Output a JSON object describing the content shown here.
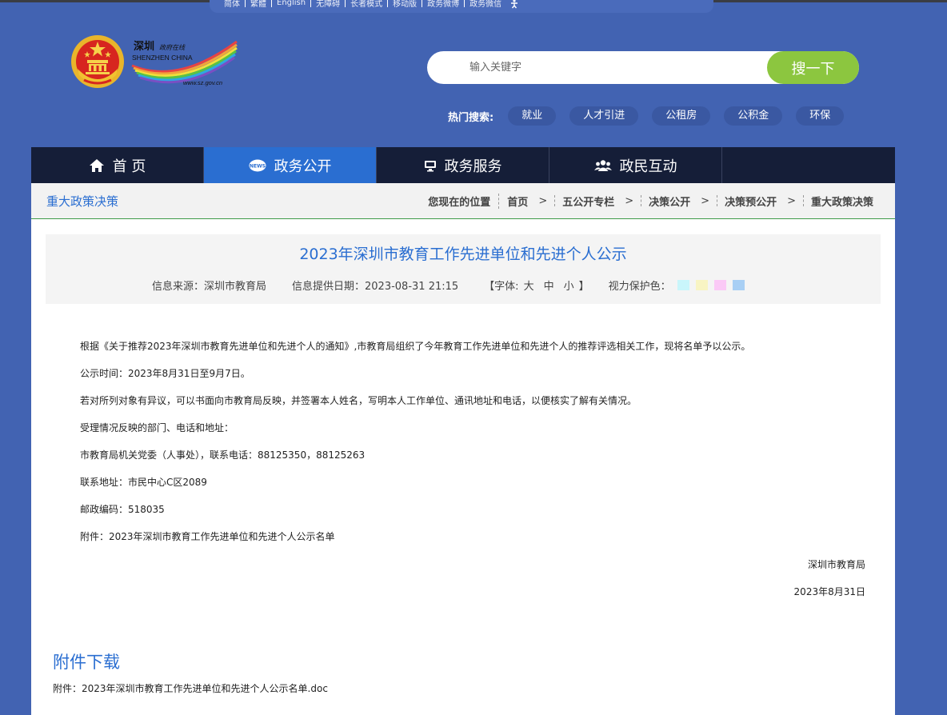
{
  "topbar": {
    "items": [
      "简体",
      "繁體",
      "English",
      "无障碍",
      "长者模式",
      "移动版",
      "政务微博",
      "政务微信"
    ]
  },
  "search": {
    "placeholder": "输入关键字",
    "button_label": "搜一下"
  },
  "hot_search": {
    "label": "热门搜索:",
    "tags": [
      "就业",
      "人才引进",
      "公租房",
      "公积金",
      "环保"
    ]
  },
  "nav": {
    "items": [
      {
        "label": "首 页",
        "icon": "home-icon"
      },
      {
        "label": "政务公开",
        "icon": "news-icon",
        "active": true
      },
      {
        "label": "政务服务",
        "icon": "monitor-icon"
      },
      {
        "label": "政民互动",
        "icon": "people-icon"
      }
    ]
  },
  "section_title": "重大政策决策",
  "breadcrumb": {
    "here_label": "您现在的位置",
    "items": [
      "首页",
      "五公开专栏",
      "决策公开",
      "决策预公开",
      "重大政策决策"
    ]
  },
  "article": {
    "title": "2023年深圳市教育工作先进单位和先进个人公示",
    "source": "信息来源：深圳市教育局",
    "date": "信息提供日期：2023-08-31 21:15",
    "font_label": "【字体:",
    "font_sizes": [
      "大",
      "中",
      "小"
    ],
    "font_end": "】",
    "eye_label": "视力保护色：",
    "eye_colors": [
      "#c9f6fb",
      "#f8f4c3",
      "#fbc9f6",
      "#a8cff4"
    ],
    "paragraphs": [
      "根据《关于推荐2023年深圳市教育先进单位和先进个人的通知》,市教育局组织了今年教育工作先进单位和先进个人的推荐评选相关工作，现将名单予以公示。",
      "公示时间：2023年8月31日至9月7日。",
      "若对所列对象有异议，可以书面向市教育局反映，并签署本人姓名，写明本人工作单位、通讯地址和电话，以便核实了解有关情况。",
      "受理情况反映的部门、电话和地址：",
      "市教育局机关党委（人事处），联系电话：88125350，88125263",
      "联系地址：市民中心C区2089",
      "邮政编码：518035",
      "附件：2023年深圳市教育工作先进单位和先进个人公示名单"
    ],
    "signature": "深圳市教育局",
    "sign_date": "2023年8月31日"
  },
  "download": {
    "title": "附件下载",
    "file": "附件：2023年深圳市教育工作先进单位和先进个人公示名单.doc"
  },
  "colors": {
    "background": "#4263b2",
    "nav": "#151e38",
    "accent": "#2a6ed1",
    "search_button": "#8cc63f"
  }
}
